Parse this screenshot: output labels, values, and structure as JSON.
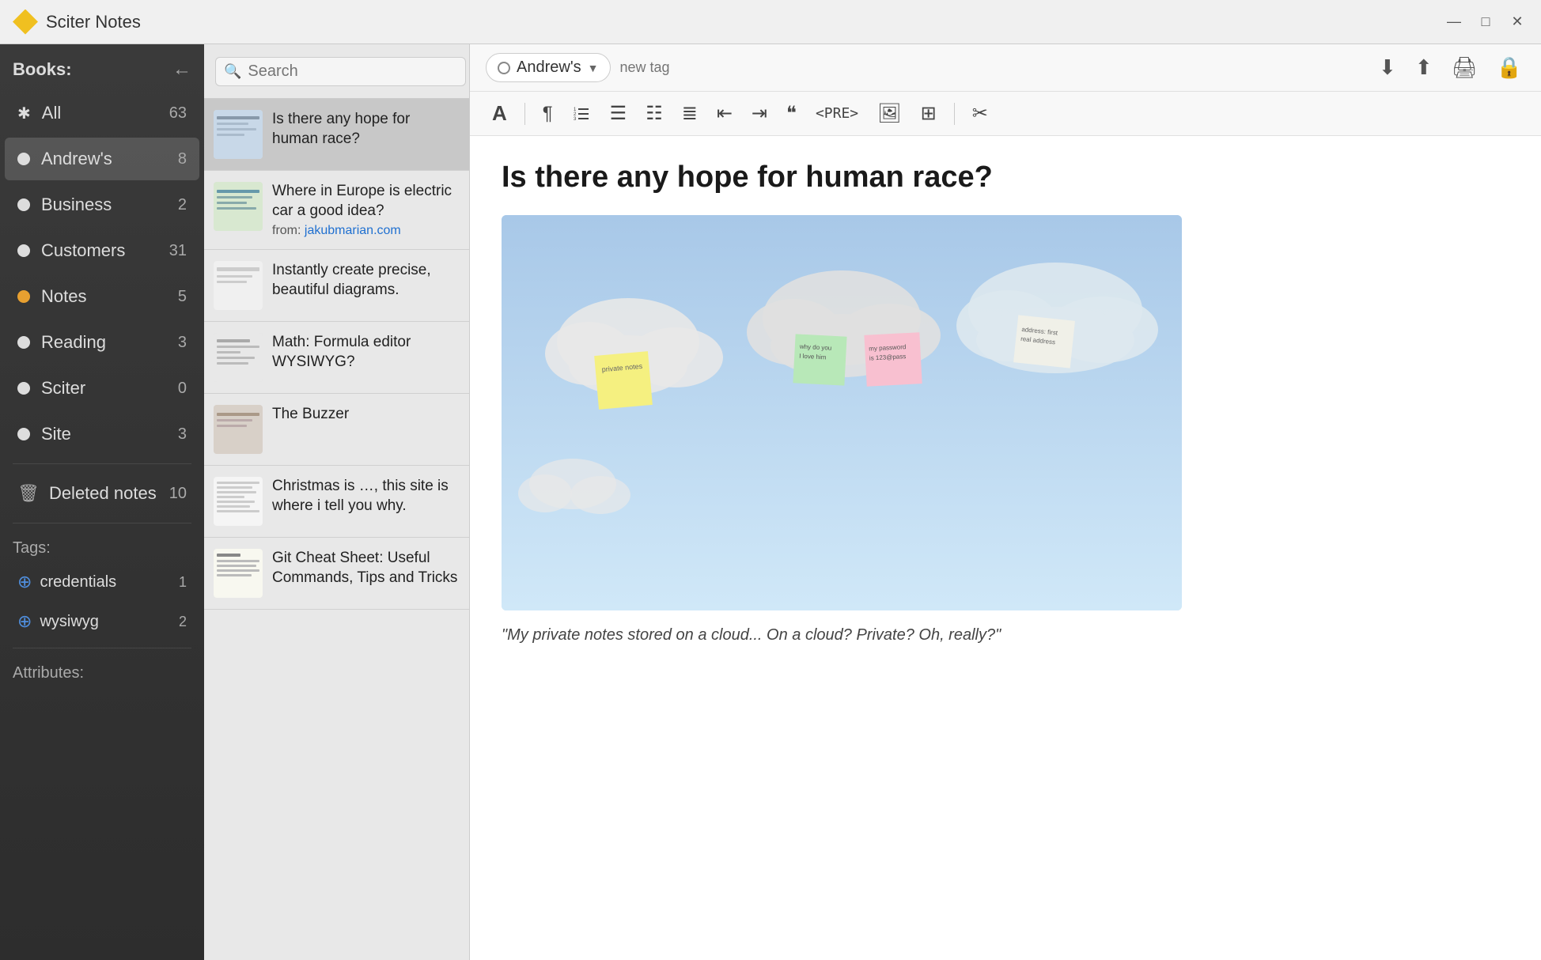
{
  "app": {
    "title": "Sciter Notes",
    "icon": "diamond-icon"
  },
  "window_controls": {
    "minimize": "—",
    "maximize": "□",
    "close": "✕"
  },
  "sidebar": {
    "header_label": "Books:",
    "back_button": "←",
    "items": [
      {
        "id": "all",
        "label": "All",
        "count": "63",
        "dot": "asterisk"
      },
      {
        "id": "andrews",
        "label": "Andrew's",
        "count": "8",
        "dot": "white",
        "active": true
      },
      {
        "id": "business",
        "label": "Business",
        "count": "2",
        "dot": "white"
      },
      {
        "id": "customers",
        "label": "Customers",
        "count": "31",
        "dot": "white"
      },
      {
        "id": "notes",
        "label": "Notes",
        "count": "5",
        "dot": "orange"
      },
      {
        "id": "reading",
        "label": "Reading",
        "count": "3",
        "dot": "white"
      },
      {
        "id": "sciter",
        "label": "Sciter",
        "count": "0",
        "dot": "white"
      },
      {
        "id": "site",
        "label": "Site",
        "count": "3",
        "dot": "white"
      }
    ],
    "deleted": {
      "label": "Deleted notes",
      "count": "10"
    },
    "tags_label": "Tags:",
    "tags": [
      {
        "label": "credentials",
        "count": "1"
      },
      {
        "label": "wysiwyg",
        "count": "2"
      }
    ],
    "attributes_label": "Attributes:"
  },
  "note_list": {
    "search_placeholder": "Search",
    "add_button": "+",
    "notes": [
      {
        "title": "Is there any hope for human race?",
        "meta": "",
        "link": "",
        "selected": true
      },
      {
        "title": "Where in Europe is electric car a good idea?",
        "meta": "from:",
        "link": "jakubmarian.com",
        "selected": false
      },
      {
        "title": "Instantly create precise, beautiful diagrams.",
        "meta": "",
        "link": "",
        "selected": false
      },
      {
        "title": "Math: Formula editor WYSIWYG?",
        "meta": "",
        "link": "",
        "selected": false
      },
      {
        "title": "The Buzzer",
        "meta": "",
        "link": "",
        "selected": false
      },
      {
        "title": "Christmas is …, this site is where i tell you why.",
        "meta": "",
        "link": "",
        "selected": false
      },
      {
        "title": "Git Cheat Sheet: Useful Commands, Tips and Tricks",
        "meta": "",
        "link": "",
        "selected": false
      }
    ]
  },
  "toolbar": {
    "notebook_name": "Andrew's",
    "tag_placeholder": "new tag",
    "download_icon": "⬇",
    "upload_icon": "⬆",
    "print_icon": "🖨",
    "lock_icon": "🔒"
  },
  "format_toolbar": {
    "buttons": [
      "A",
      "¶",
      "≡",
      "☰",
      "☷",
      "≣",
      "«»",
      "⇤",
      "⇥",
      "❝",
      "<PRE>",
      "🖼",
      "⊞",
      "✂"
    ]
  },
  "content": {
    "title": "Is there any hope for human race?",
    "quote": "\"My private notes stored on a cloud... On a cloud? Private? Oh, really?\""
  }
}
